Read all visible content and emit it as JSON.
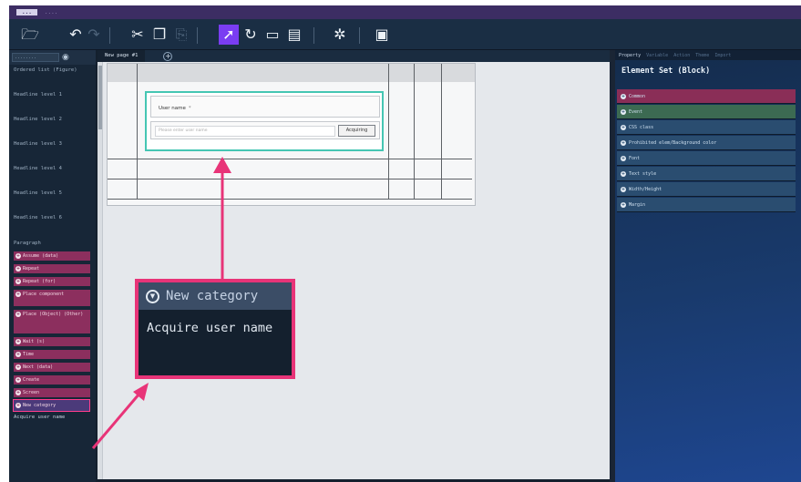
{
  "app": {
    "brand": "...",
    "menu_item": "....",
    "accent_color": "#7a3df2",
    "highlight_color": "#e83478",
    "selection_color": "#45c6b3"
  },
  "toolbar": {
    "icons": [
      "folder-icon",
      "undo-icon",
      "redo-icon",
      "cut-icon",
      "copy-icon",
      "paste-icon",
      "select-pointer-icon",
      "lasso-icon",
      "monitor-icon",
      "save-icon",
      "bug-icon",
      "preview-window-icon"
    ]
  },
  "sidebar": {
    "search_placeholder": "........",
    "upper_items": [
      "Ordered list (Figure)",
      "Headline level 1",
      "Headline level 2",
      "Headline level 3",
      "Headline level 4",
      "Headline level 5",
      "Headline level 6"
    ],
    "section_label": "Paragraph",
    "pink_items": [
      "Assume (data)",
      "Repeat",
      "Repeat (for)",
      "Place component",
      "Place (Object) (Other)",
      "Wait (s)",
      "Time",
      "Next (data)",
      "Create",
      "Screen"
    ],
    "selected_item": "New category",
    "output_text": "Acquire user name"
  },
  "canvas": {
    "tab_label": "New page #1",
    "add_tab_icon": "plus-circle-icon"
  },
  "form": {
    "label": "User name",
    "required_mark": "*",
    "placeholder": "Please enter user name",
    "button_label": "Acquiring"
  },
  "property_panel": {
    "tabs": [
      "Property",
      "Variable",
      "Action",
      "Theme",
      "Import"
    ],
    "title": "Element Set (Block)",
    "rows": [
      {
        "label": "Common",
        "tone": "pink"
      },
      {
        "label": "Event",
        "tone": "green"
      },
      {
        "label": "CSS class",
        "tone": "blue"
      },
      {
        "label": "Prohibited elem/Background color",
        "tone": "blue"
      },
      {
        "label": "Font",
        "tone": "blue"
      },
      {
        "label": "Text style",
        "tone": "blue"
      },
      {
        "label": "Width/Height",
        "tone": "blue"
      },
      {
        "label": "Margin",
        "tone": "blue"
      }
    ]
  },
  "callout": {
    "header": "New category",
    "body": "Acquire user name"
  }
}
